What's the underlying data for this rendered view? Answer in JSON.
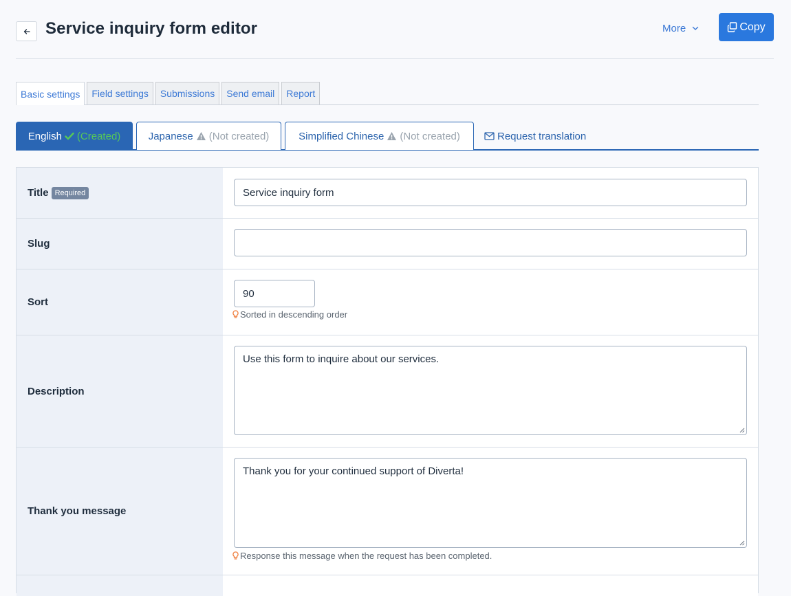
{
  "header": {
    "title": "Service inquiry form editor",
    "more_label": "More",
    "copy_label": "Copy"
  },
  "tabs": [
    {
      "label": "Basic settings",
      "active": true
    },
    {
      "label": "Field settings",
      "active": false
    },
    {
      "label": "Submissions",
      "active": false
    },
    {
      "label": "Send email",
      "active": false
    },
    {
      "label": "Report",
      "active": false
    }
  ],
  "languages": [
    {
      "name": "English",
      "status": "(Created)",
      "active": true
    },
    {
      "name": "Japanese",
      "status": "(Not created)",
      "active": false
    },
    {
      "name": "Simplified Chinese",
      "status": "(Not created)",
      "active": false
    }
  ],
  "request_translation_label": "Request translation",
  "form": {
    "title": {
      "label": "Title",
      "badge": "Required",
      "value": "Service inquiry form"
    },
    "slug": {
      "label": "Slug",
      "value": ""
    },
    "sort": {
      "label": "Sort",
      "value": "90",
      "hint": "Sorted in descending order"
    },
    "description": {
      "label": "Description",
      "value": "Use this form to inquire about our services."
    },
    "thank_you": {
      "label": "Thank you message",
      "value": "Thank you for your continued support of Diverta!",
      "hint": "Response this message when the request has been completed."
    }
  },
  "colors": {
    "primary": "#2a78de",
    "tab_active": "#2a66b4",
    "created_green": "#57c957",
    "label_bg": "#edf1f8",
    "hint_icon": "#f08040"
  },
  "icons": {
    "back": "arrow-left-icon",
    "more": "chevron-down-icon",
    "copy": "copy-icon",
    "created": "check-icon",
    "not_created": "warning-icon",
    "request": "envelope-icon",
    "hint": "lightbulb-icon"
  }
}
